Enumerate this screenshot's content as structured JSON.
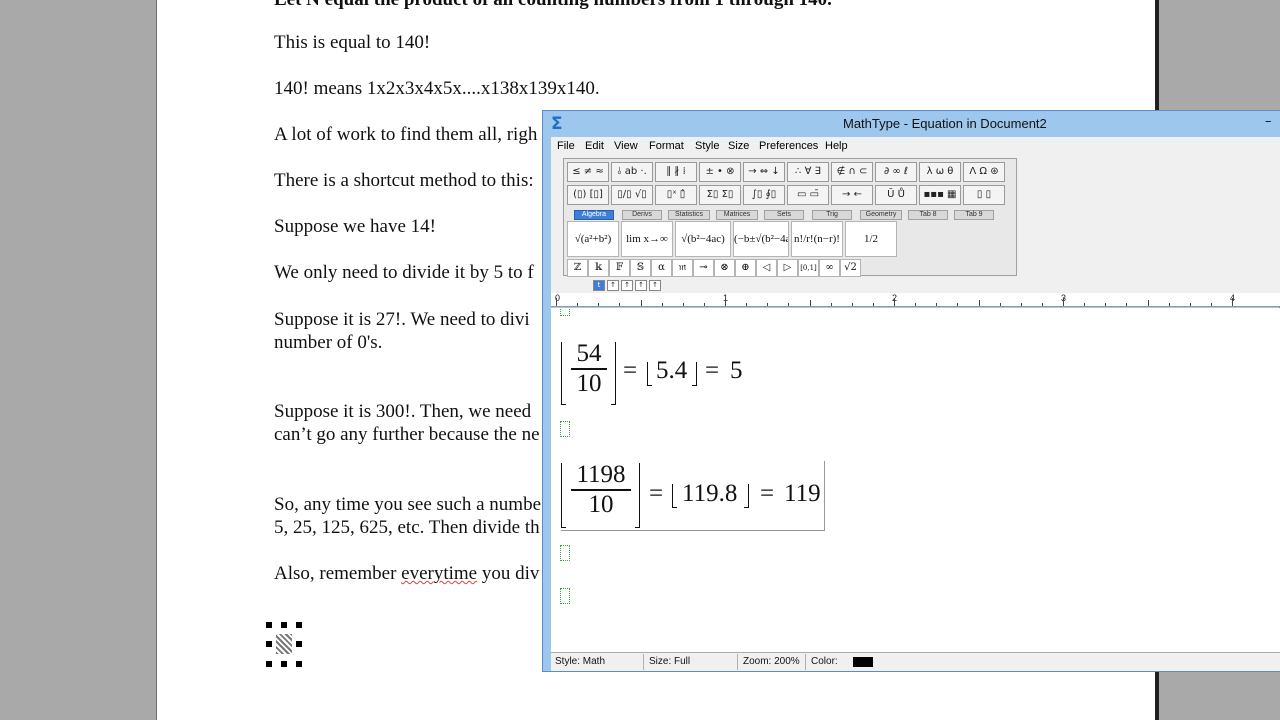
{
  "document": {
    "paragraphs": [
      "Let N equal the product of all counting numbers from 1 through 140.",
      "This is equal to 140!",
      "140! means 1x2x3x4x5x....x138x139x140.",
      "A lot of work to find them all, righ",
      "There is a shortcut method to this:",
      "Suppose we have 14!",
      "We only need to divide it by 5 to f",
      "Suppose it is 27!. We need to divi",
      "number of 0's.",
      "Suppose it is 300!. Then, we need",
      "can’t go any further because the ne",
      "So, any time you see such a numbe",
      "5, 25, 125, 625, etc. Then divide th",
      "Also, remember ",
      "everytime",
      " you div"
    ]
  },
  "mathtype": {
    "title": "MathType - Equation in Document2",
    "app_icon": "Σ",
    "minimize_glyph": "–",
    "menu": [
      "File",
      "Edit",
      "View",
      "Format",
      "Style",
      "Size",
      "Preferences",
      "Help"
    ],
    "palette_row1": [
      "≤ ≠ ≈",
      "⫰ ab ·.",
      "∥ ∦ ⁞",
      "± • ⊗",
      "→ ⇔ ↓",
      "∴ ∀ ∃",
      "∉ ∩ ⊂",
      "∂ ∞ ℓ",
      "λ ω θ",
      "Λ Ω ⊛"
    ],
    "palette_row2": [
      "(▯) [▯]",
      "▯/▯ √▯",
      "▯ˣ ▯̂",
      "Σ▯ Σ▯",
      "∫▯ ∮▯",
      "▭ ▭̄",
      "→ ←",
      "Ū Ů",
      "▪▪▪ ▦",
      "▯ ▯"
    ],
    "tabs": [
      "Algebra",
      "Derivs",
      "Statistics",
      "Matrices",
      "Sets",
      "Trig",
      "Geometry",
      "Tab 8",
      "Tab 9"
    ],
    "templates": [
      "√(a²+b²)",
      "lim x→∞",
      "√(b²−4ac)",
      "(−b±√(b²−4ac))/2a",
      "n!/r!(n−r)!",
      "1/2"
    ],
    "symbols": [
      "ℤ",
      "𝕜",
      "𝔽",
      "𝕊",
      "α",
      "𝔪",
      "⊸",
      "⊗",
      "⊕",
      "◁",
      "▷",
      "[0,1]",
      "∞",
      "√2"
    ],
    "small_tools": [
      "t",
      "↑",
      "↑",
      "↑",
      "↑"
    ],
    "ruler_numbers": [
      "0",
      "1",
      "2",
      "3",
      "4"
    ],
    "equations": {
      "eq1": {
        "numerator": "54",
        "denominator": "10",
        "eq_sign1": "=",
        "inner": "5.4",
        "eq_sign2": "=",
        "result": "5"
      },
      "eq2": {
        "numerator": "1198",
        "denominator": "10",
        "eq_sign1": "=",
        "inner": "119.8",
        "eq_sign2": "=",
        "result": "119"
      }
    },
    "status": {
      "style": "Style: Math",
      "size": "Size: Full",
      "zoom": "Zoom: 200%",
      "color_label": "Color:",
      "color_value": "#000000"
    }
  }
}
